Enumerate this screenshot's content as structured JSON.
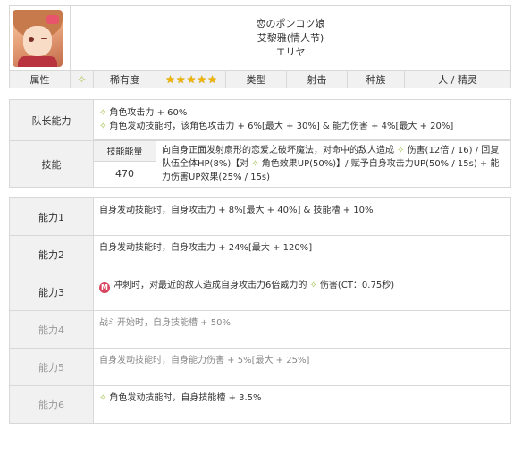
{
  "character": {
    "name_jp": "恋のポンコツ娘",
    "name_cn": "艾黎雅(情人节)",
    "name_short": "エリヤ"
  },
  "attributes": {
    "attr_label": "属性",
    "attr_icon": "diamond-icon",
    "rarity_label": "稀有度",
    "rarity_stars": 5,
    "type_label": "类型",
    "type_value": "射击",
    "race_label": "种族",
    "race_value": "人 / 精灵"
  },
  "leader": {
    "label": "队长能力",
    "lines": [
      "角色攻击力 + 60%",
      "角色发动技能时，该角色攻击力 + 6%[最大 + 30%] & 能力伤害 + 4%[最大 + 20%]"
    ]
  },
  "skill": {
    "label": "技能",
    "energy_label": "技能能量",
    "energy_value": "470",
    "desc_a": "向自身正面发射扇形的恋爱之破坏魔法，对命中的敌人造成",
    "desc_b": "伤害(12倍 / 16) / 回复队伍全体HP(8%)【对",
    "desc_c": "角色效果UP(50%)】/ 赋予自身攻击力UP(50% / 15s) + 能力伤害UP效果(25% / 15s)"
  },
  "abilities": [
    {
      "label": "能力1",
      "text": "自身发动技能时，自身攻击力 + 8%[最大 + 40%] & 技能槽 + 10%"
    },
    {
      "label": "能力2",
      "text": "自身发动技能时，自身攻击力 + 24%[最大 + 120%]"
    },
    {
      "label": "能力3",
      "text_a": "冲刺时，对最近的敌人造成自身攻击力6倍威力的",
      "text_b": "伤害(CT：0.75秒)"
    },
    {
      "label": "能力4",
      "text": "战斗开始时，自身技能槽 + 50%"
    },
    {
      "label": "能力5",
      "text": "自身发动技能时，自身能力伤害 + 5%[最大 + 25%]"
    },
    {
      "label": "能力6",
      "text": "角色发动技能时，自身技能槽 + 3.5%"
    }
  ],
  "colors": {
    "header_bg": "#f1f1f1",
    "border": "#d8d8d8",
    "gem": "#9fc04a",
    "m_icon": "#d9435e"
  }
}
